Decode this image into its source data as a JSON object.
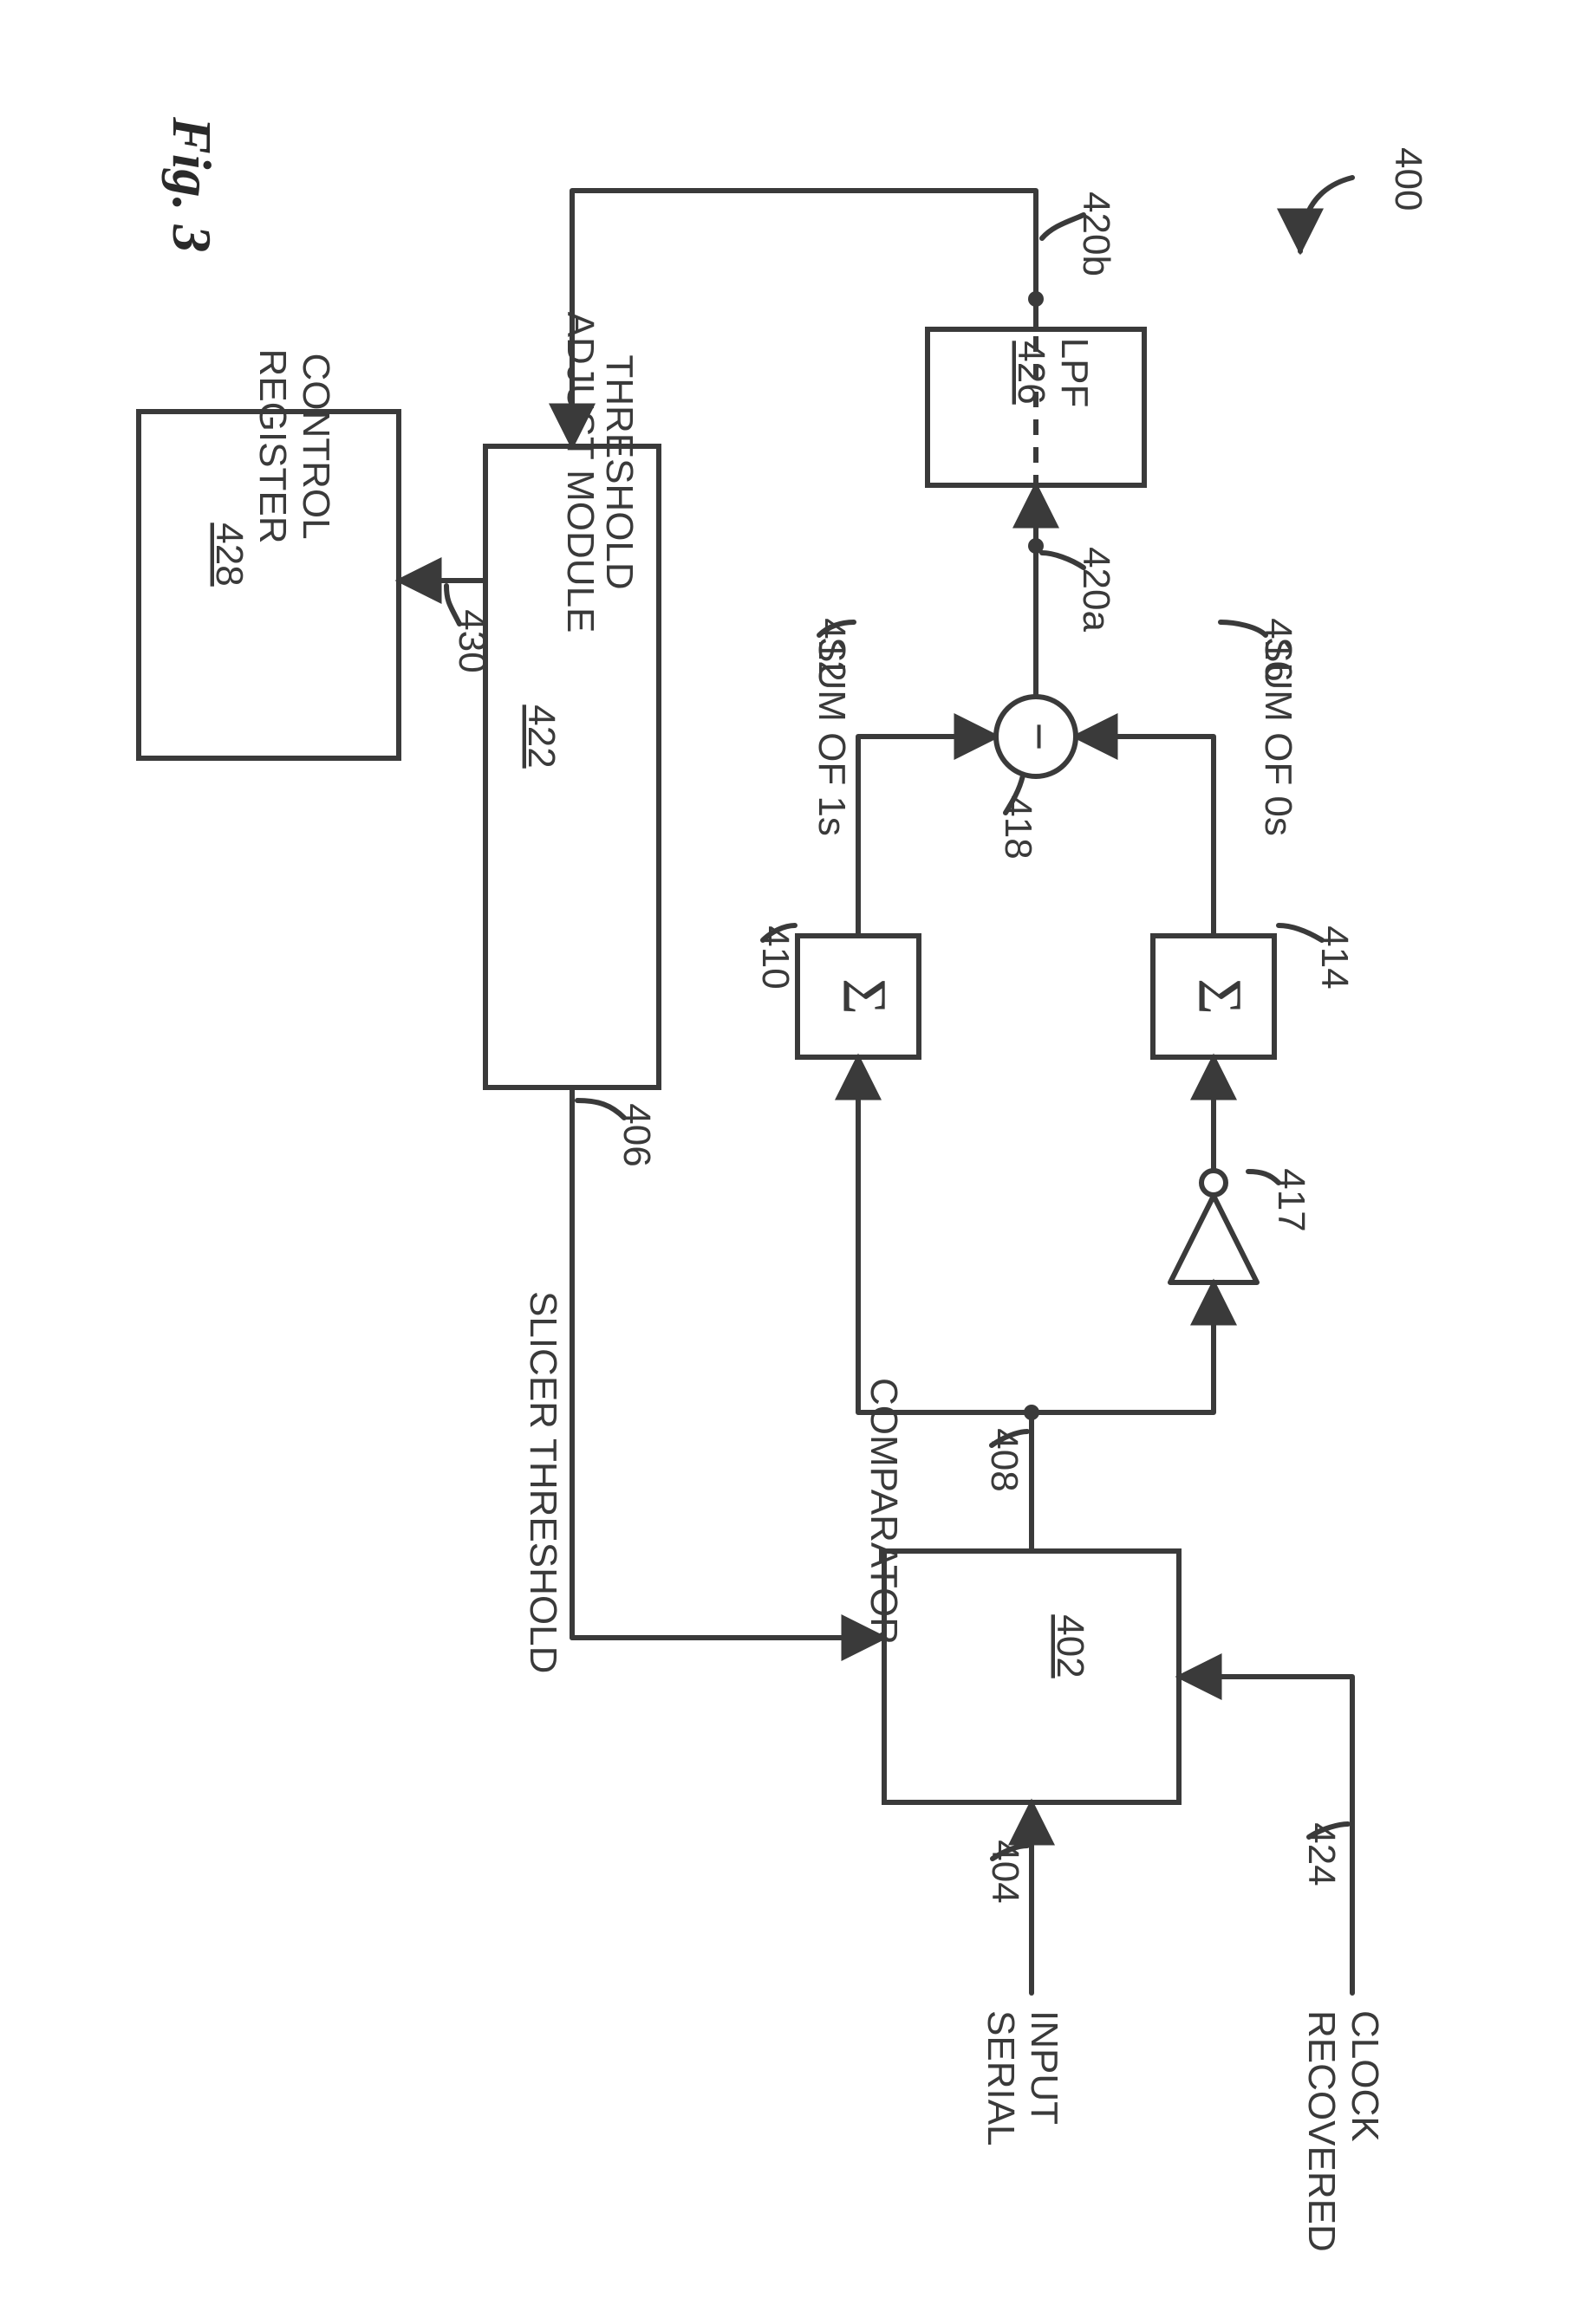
{
  "figure": {
    "title": "Fig. 3"
  },
  "refnums": {
    "system": "400",
    "comparator_block": "402",
    "serial_input": "404",
    "threshold_wire": "406",
    "comparator_out": "408",
    "sum1_block": "410",
    "sum1_wire": "412",
    "sum0_block": "414",
    "sum0_wire": "416",
    "inverter": "417",
    "subtractor": "418",
    "sub_out_a": "420a",
    "sub_out_b": "420b",
    "threshold_adjust": "422",
    "recovered_clock": "424",
    "lpf": "426",
    "control_register": "428",
    "ctrl_wire": "430"
  },
  "labels": {
    "slicer_threshold_1": "SLICER",
    "slicer_threshold_2": "THRESHOLD",
    "comparator": "COMPARATOR",
    "serial_1": "SERIAL",
    "serial_2": "INPUT",
    "recovered_1": "RECOVERED",
    "recovered_2": "CLOCK",
    "sum_of_1s": "SUM OF 1s",
    "sum_of_0s": "SUM OF 0s",
    "control_1": "CONTROL",
    "control_2": "REGISTER",
    "threshold_1": "THRESHOLD",
    "threshold_2": "ADJUST MODULE",
    "lpf": "LPF"
  }
}
